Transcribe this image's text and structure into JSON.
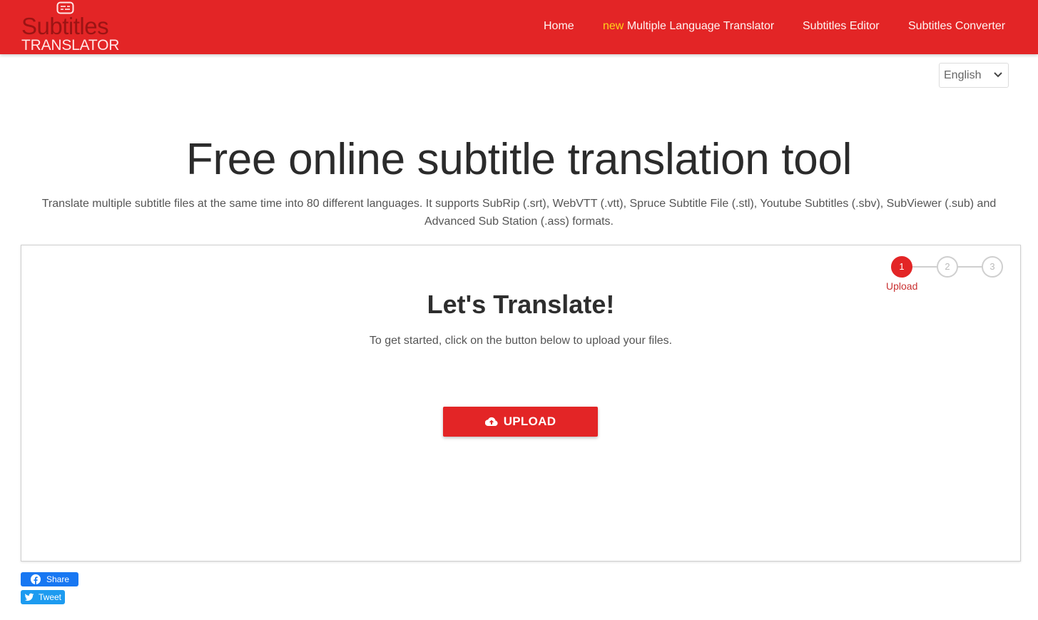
{
  "header": {
    "logo": {
      "line1": "Subtitles",
      "line2": "TRANSLATOR",
      "icon": "subtitles-icon"
    },
    "nav": [
      {
        "label": "Home"
      },
      {
        "badge": "new",
        "label": "Multiple Language Translator"
      },
      {
        "label": "Subtitles Editor"
      },
      {
        "label": "Subtitles Converter"
      }
    ],
    "brand_color": "#e32526",
    "badge_color": "#ffd21a"
  },
  "language_select": {
    "selected": "English",
    "icon": "chevron-down-icon"
  },
  "hero": {
    "title": "Free online subtitle translation tool",
    "description": "Translate multiple subtitle files at the same time into 80 different languages. It supports SubRip (.srt), WebVTT (.vtt), Spruce Subtitle File (.stl), Youtube Subtitles (.sbv), SubViewer (.sub) and Advanced Sub Station (.ass) formats."
  },
  "card": {
    "stepper": {
      "steps": [
        {
          "number": "1",
          "label": "Upload",
          "active": true
        },
        {
          "number": "2",
          "label": "",
          "active": false
        },
        {
          "number": "3",
          "label": "",
          "active": false
        }
      ]
    },
    "heading": "Let's Translate!",
    "text": "To get started, click on the button below to upload your files.",
    "upload_button": {
      "label": "UPLOAD",
      "icon": "cloud-upload-icon"
    }
  },
  "social": {
    "facebook": {
      "label": "Share",
      "icon": "facebook-icon"
    },
    "twitter": {
      "label": "Tweet",
      "icon": "twitter-icon"
    }
  }
}
